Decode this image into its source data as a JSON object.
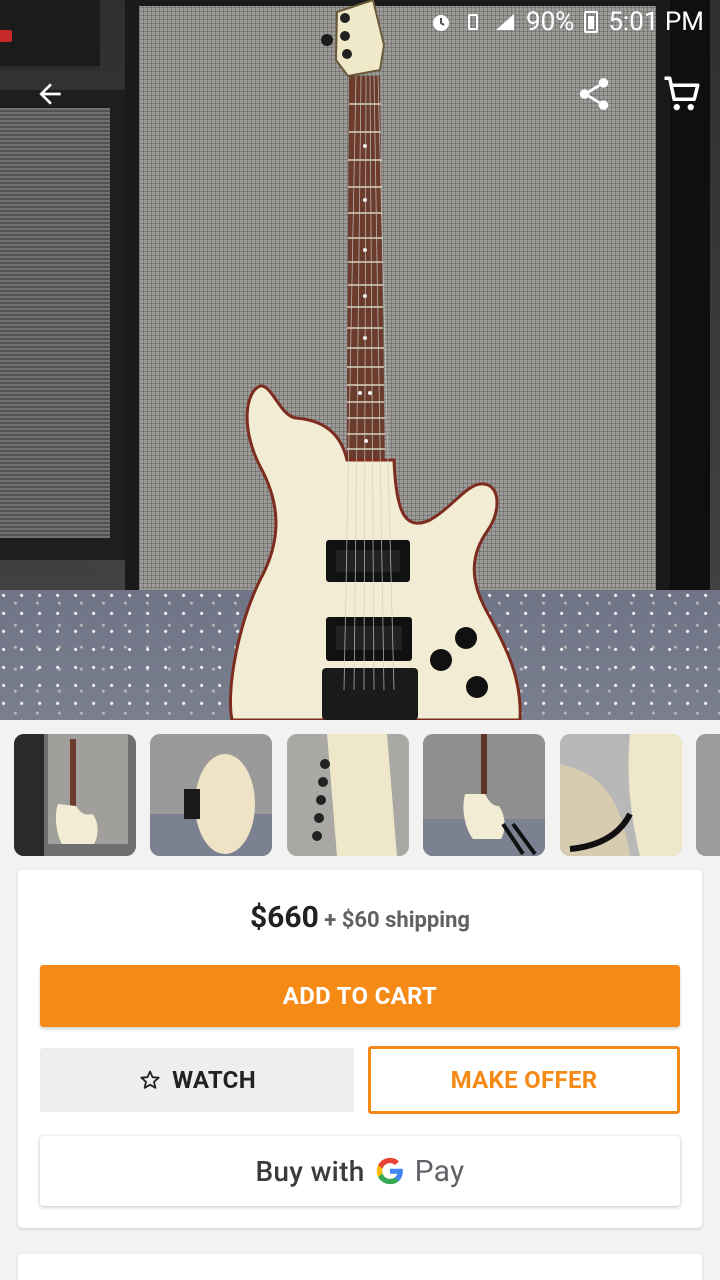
{
  "status_bar": {
    "battery": "90%",
    "time": "5:01 PM"
  },
  "icons": {
    "back": "back-arrow-icon",
    "share": "share-icon",
    "cart": "cart-icon",
    "watch": "star-outline-icon",
    "google": "google-g-icon"
  },
  "listing": {
    "price": "$660",
    "shipping": "+ $60 shipping"
  },
  "actions": {
    "add_to_cart": "ADD TO CART",
    "watch": "WATCH",
    "make_offer": "MAKE OFFER",
    "buy_with": "Buy with",
    "pay": "Pay"
  },
  "colors": {
    "accent": "#f58a16",
    "button_grey": "#eeeeee"
  }
}
